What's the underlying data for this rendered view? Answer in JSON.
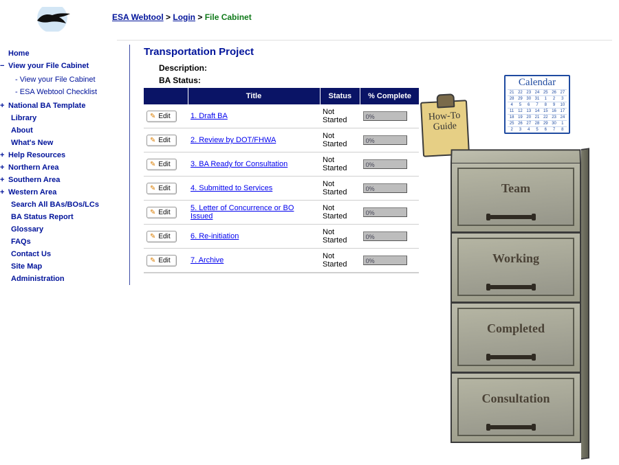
{
  "breadcrumb": {
    "root": "ESA Webtool",
    "login": "Login",
    "current": "File Cabinet"
  },
  "sidebar": {
    "items": [
      {
        "label": "Home",
        "kind": "plain"
      },
      {
        "label": "View your File Cabinet",
        "kind": "col",
        "sub": [
          {
            "label": "View your File Cabinet"
          },
          {
            "label": "ESA Webtool Checklist"
          }
        ]
      },
      {
        "label": "National BA Template",
        "kind": "exp"
      },
      {
        "label": "Library",
        "kind": "plain-indent"
      },
      {
        "label": "About",
        "kind": "plain-indent"
      },
      {
        "label": "What's New",
        "kind": "plain-indent"
      },
      {
        "label": "Help Resources",
        "kind": "exp"
      },
      {
        "label": "Northern Area",
        "kind": "exp"
      },
      {
        "label": "Southern Area",
        "kind": "exp"
      },
      {
        "label": "Western Area",
        "kind": "exp"
      },
      {
        "label": "Search All BAs/BOs/LCs",
        "kind": "plain-indent"
      },
      {
        "label": "BA Status Report",
        "kind": "plain-indent"
      },
      {
        "label": "Glossary",
        "kind": "plain-indent"
      },
      {
        "label": "FAQs",
        "kind": "plain-indent"
      },
      {
        "label": "Contact Us",
        "kind": "plain-indent"
      },
      {
        "label": "Site Map",
        "kind": "plain-indent"
      },
      {
        "label": "Administration",
        "kind": "plain-indent"
      }
    ]
  },
  "page": {
    "title": "Transportation Project",
    "desc_label": "Description:",
    "status_label": "BA Status:"
  },
  "table": {
    "headers": {
      "edit": "",
      "title": "Title",
      "status": "Status",
      "pct": "% Complete"
    },
    "edit_label": "Edit",
    "rows": [
      {
        "title": "1. Draft BA",
        "status": "Not Started",
        "pct": "0%"
      },
      {
        "title": "2. Review by DOT/FHWA",
        "status": "Not Started",
        "pct": "0%"
      },
      {
        "title": "3. BA Ready for Consultation",
        "status": "Not Started",
        "pct": "0%"
      },
      {
        "title": "4. Submitted to Services",
        "status": "Not Started",
        "pct": "0%"
      },
      {
        "title": "5. Letter of Concurrence or BO Issued",
        "status": "Not Started",
        "pct": "0%"
      },
      {
        "title": "6. Re-initiation",
        "status": "Not Started",
        "pct": "0%"
      },
      {
        "title": "7. Archive",
        "status": "Not Started",
        "pct": "0%"
      }
    ]
  },
  "illus": {
    "clipboard_line1": "How-To",
    "clipboard_line2": "Guide",
    "calendar_title": "Calendar",
    "drawers": [
      "Team",
      "Working",
      "Completed",
      "Consultation"
    ]
  }
}
